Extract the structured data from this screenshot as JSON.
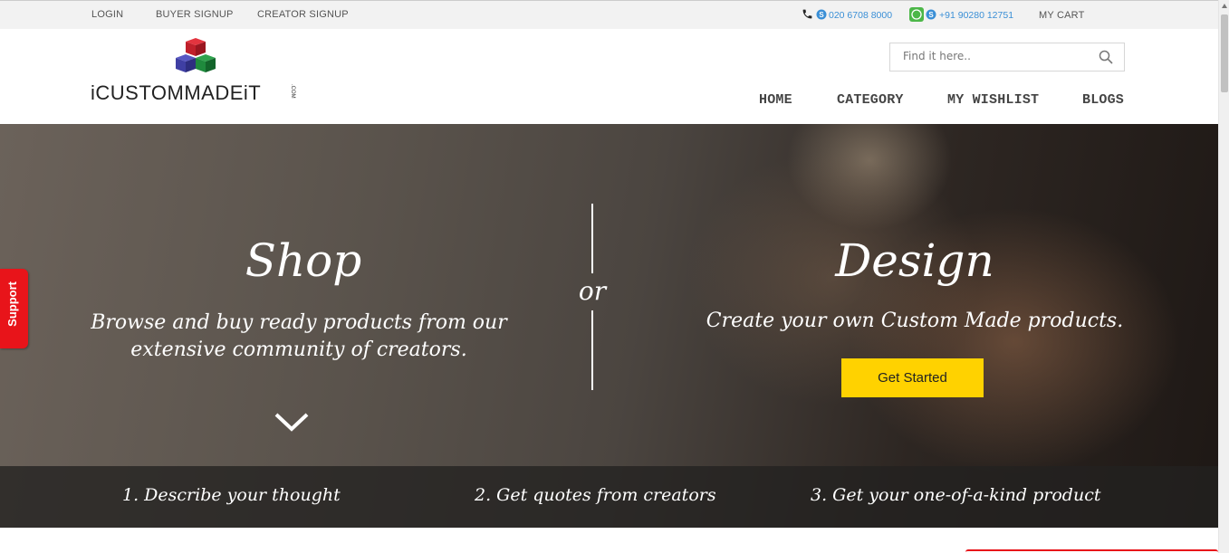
{
  "topbar": {
    "login": "LOGIN",
    "buyer_signup": "BUYER SIGNUP",
    "creator_signup": "CREATOR SIGNUP",
    "phone1": "020 6708 8000",
    "phone2": "+91 90280 12751",
    "cart": "MY CART"
  },
  "logo": {
    "text": "iCUSTOMMADEiT",
    "com": ".COM"
  },
  "search": {
    "placeholder": "Find it here.."
  },
  "nav": {
    "home": "HOME",
    "category": "CATEGORY",
    "wishlist": "MY WISHLIST",
    "blogs": "BLOGS"
  },
  "hero": {
    "shop_title": "Shop",
    "shop_subtitle": "Browse and buy ready products from our extensive community of creators.",
    "or": "or",
    "design_title": "Design",
    "design_subtitle": "Create your own Custom Made products.",
    "cta": "Get Started"
  },
  "steps": [
    "1. Describe your thought",
    "2. Get quotes from creators",
    "3. Get your one-of-a-kind product"
  ],
  "support": "Support",
  "colors": {
    "cta": "#ffd200",
    "support": "#e8141a",
    "link": "#3a8fd6"
  }
}
